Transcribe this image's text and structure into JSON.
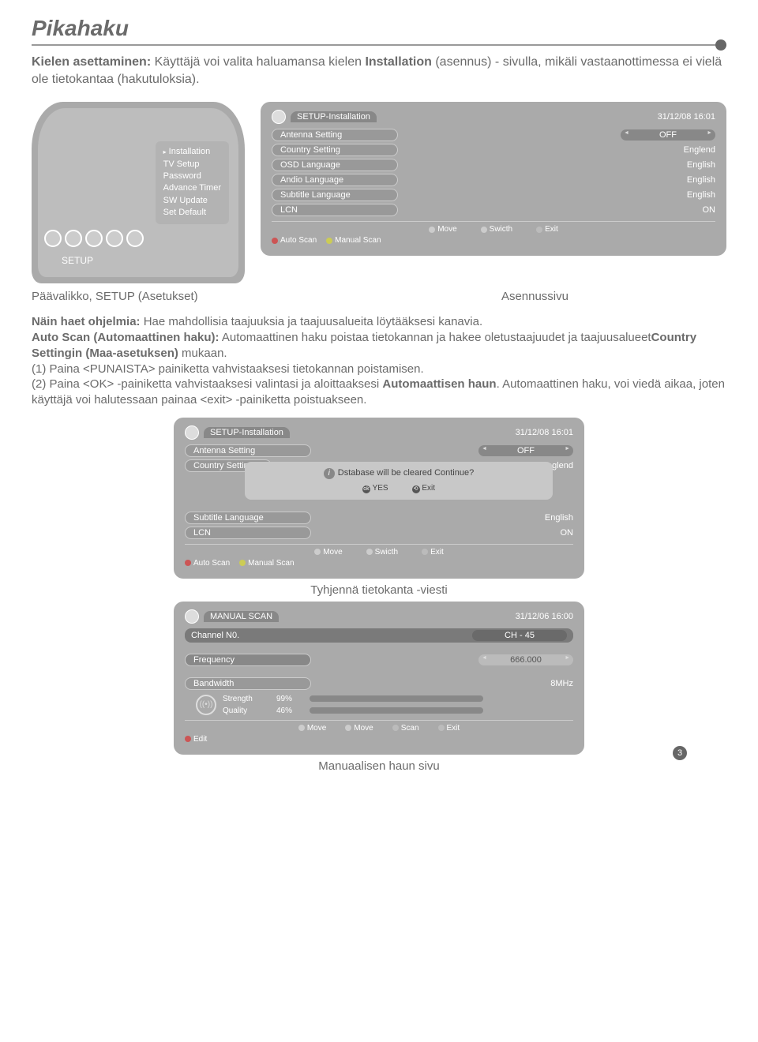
{
  "page_title": "Pikahaku",
  "intro_prefix": "Kielen asettaminen: ",
  "intro_mid1": "Käyttäjä voi valita haluamansa kielen ",
  "intro_bold1": "Installation",
  "intro_mid2": " (asennus) - sivulla, mikäli vastaanottimessa ei vielä ole tietokantaa (hakutuloksia).",
  "sidebar": {
    "items": [
      "Installation",
      "TV Setup",
      "Password",
      "Advance Timer",
      "SW Update",
      "Set Default"
    ],
    "setup_label": "SETUP"
  },
  "osd1": {
    "title": "SETUP-Installation",
    "time": "31/12/08 16:01",
    "rows": [
      {
        "label": "Antenna Setting",
        "value": "OFF"
      },
      {
        "label": "Country Setting",
        "value": "Englend"
      },
      {
        "label": "OSD Language",
        "value": "English"
      },
      {
        "label": "Andio Language",
        "value": "English"
      },
      {
        "label": "Subtitle Language",
        "value": "English"
      },
      {
        "label": "LCN",
        "value": "ON"
      }
    ],
    "footer_top": {
      "move": "Move",
      "switch": "Swicth",
      "exit": "Exit"
    },
    "footer_bot": {
      "auto": "Auto Scan",
      "manual": "Manual Scan"
    }
  },
  "captions": {
    "left": "Päävalikko, SETUP (Asetukset)",
    "right": "Asennussivu"
  },
  "body": {
    "l1_bold": "Näin haet ohjelmia:",
    "l1_rest": " Hae mahdollisia taajuuksia ja taajuusalueita löytääksesi kanavia.",
    "l2_bold": "Auto Scan (Automaattinen haku):",
    "l2_rest": " Automaattinen haku poistaa tietokannan ja hakee oletustaajuudet ja taajuusalueet",
    "l2_bold2": "Country Settingin (Maa-asetuksen)",
    "l2_rest2": " mukaan.",
    "l3": "(1) Paina <PUNAISTA> painiketta vahvistaaksesi tietokannan poistamisen.",
    "l4a": "(2) Paina <OK> -painiketta vahvistaaksesi valintasi ja aloittaaksesi ",
    "l4_bold": "Automaattisen haun",
    "l4b": ". Automaattinen haku, voi viedä aikaa, joten käyttäjä voi halutessaan painaa <exit> -painiketta poistuakseen."
  },
  "osd2": {
    "title": "SETUP-Installation",
    "time": "31/12/08 16:01",
    "antenna": {
      "label": "Antenna Setting",
      "value": "OFF"
    },
    "country": {
      "label": "Country Setting",
      "value": "Englend"
    },
    "dialog": {
      "text": "Dstabase will be cleared Continue?",
      "yes": "YES",
      "exit": "Exit"
    },
    "subtitle": {
      "label": "Subtitle Language",
      "value": "English"
    },
    "lcn": {
      "label": "LCN",
      "value": "ON"
    },
    "footer_top": {
      "move": "Move",
      "switch": "Swicth",
      "exit": "Exit"
    },
    "footer_bot": {
      "auto": "Auto Scan",
      "manual": "Manual Scan"
    }
  },
  "caption2": "Tyhjennä tietokanta -viesti",
  "osd3": {
    "title": "MANUAL SCAN",
    "time": "31/12/06 16:00",
    "channel": {
      "label": "Channel N0.",
      "value": "CH - 45"
    },
    "freq": {
      "label": "Frequency",
      "value": "666.000"
    },
    "bw": {
      "label": "Bandwidth",
      "value": "8MHz"
    },
    "strength": {
      "label": "Strength",
      "value": "99%"
    },
    "quality": {
      "label": "Quality",
      "value": "46%"
    },
    "footer": {
      "move1": "Move",
      "move2": "Move",
      "scan": "Scan",
      "exit": "Exit"
    },
    "edit": "Edit"
  },
  "caption3": "Manuaalisen haun sivu",
  "page_num": "3"
}
